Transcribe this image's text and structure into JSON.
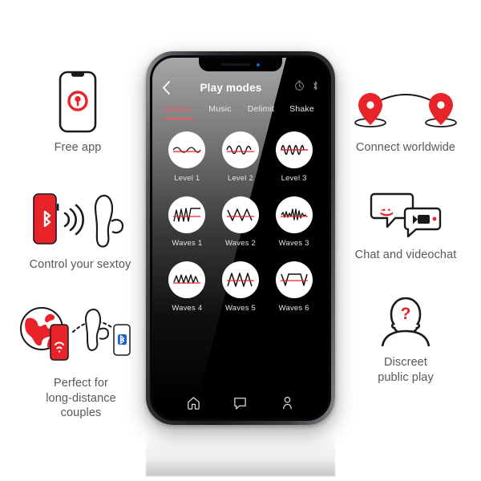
{
  "theme": {
    "brand_red": "#E8232A",
    "accent_pink": "#EF5A5E",
    "caption_gray": "#58585A",
    "screen_black": "#000000",
    "page_background": "#FFFFFF",
    "bluetooth_blue": "#1D63C8"
  },
  "phone": {
    "header": {
      "back_icon": "chevron-left-icon",
      "title": "Play modes",
      "timer_icon": "timer-icon",
      "bluetooth_icon": "bluetooth-icon"
    },
    "tabs": [
      {
        "label": "Classic",
        "active": true
      },
      {
        "label": "Music",
        "active": false
      },
      {
        "label": "Delimit",
        "active": false
      },
      {
        "label": "Shake",
        "active": false
      }
    ],
    "modes": [
      {
        "label": "Level 1",
        "icon": "wave-low-sine-icon"
      },
      {
        "label": "Level 2",
        "icon": "wave-medium-sine-icon"
      },
      {
        "label": "Level 3",
        "icon": "wave-high-sine-icon"
      },
      {
        "label": "Waves 1",
        "icon": "wave-ramp-plateau-icon"
      },
      {
        "label": "Waves 2",
        "icon": "wave-zigzag-wide-icon"
      },
      {
        "label": "Waves 3",
        "icon": "wave-burst-icon"
      },
      {
        "label": "Waves 4",
        "icon": "wave-zigzag-dense-icon"
      },
      {
        "label": "Waves 5",
        "icon": "wave-triangle-train-icon"
      },
      {
        "label": "Waves 6",
        "icon": "wave-trapezoid-icon"
      }
    ],
    "bottom_nav": [
      {
        "name": "home",
        "icon": "home-icon"
      },
      {
        "name": "chat",
        "icon": "chat-bubble-icon"
      },
      {
        "name": "profile",
        "icon": "person-icon"
      }
    ]
  },
  "features": {
    "free_app": {
      "caption": "Free app",
      "icon": "phone-with-logo-icon"
    },
    "control_sextoy": {
      "caption": "Control your sextoy",
      "icon": "phone-bluetooth-toy-icon"
    },
    "long_distance": {
      "caption": "Perfect for\nlong-distance\ncouples",
      "icon": "globe-phones-toy-icon"
    },
    "connect_worldwide": {
      "caption": "Connect worldwide",
      "icon": "two-map-pins-icon"
    },
    "chat_videochat": {
      "caption": "Chat and videochat",
      "icon": "speech-bubbles-video-icon",
      "emoticon": ";)"
    },
    "discreet_play": {
      "caption": "Discreet\npublic play",
      "icon": "anonymous-person-icon",
      "symbol": "?"
    }
  }
}
